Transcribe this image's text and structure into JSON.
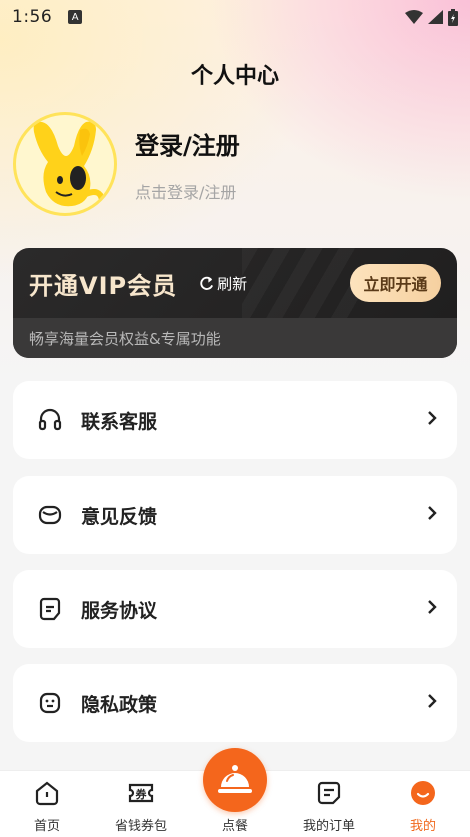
{
  "status_bar": {
    "time": "1:56",
    "notification_letter": "A"
  },
  "header": {
    "title": "个人中心"
  },
  "profile": {
    "title": "登录/注册",
    "subtitle": "点击登录/注册"
  },
  "vip": {
    "title": "开通VIP会员",
    "refresh_label": "刷新",
    "button_label": "立即开通",
    "subtitle": "畅享海量会员权益&专属功能"
  },
  "menu": [
    {
      "label": "联系客服",
      "icon": "headset-icon"
    },
    {
      "label": "意见反馈",
      "icon": "feedback-icon"
    },
    {
      "label": "服务协议",
      "icon": "agreement-icon"
    },
    {
      "label": "隐私政策",
      "icon": "privacy-icon"
    }
  ],
  "tabbar": {
    "items": [
      {
        "label": "首页",
        "icon": "home-icon"
      },
      {
        "label": "省钱券包",
        "icon": "coupon-icon",
        "icon_text": "券"
      },
      {
        "label": "点餐",
        "icon": "service-bell-icon"
      },
      {
        "label": "我的订单",
        "icon": "order-list-icon"
      },
      {
        "label": "我的",
        "icon": "profile-icon",
        "active": true
      }
    ]
  },
  "colors": {
    "accent": "#f4661c",
    "vip_gold": "#f7e6cc",
    "vip_bg": "#1f1e1e"
  }
}
